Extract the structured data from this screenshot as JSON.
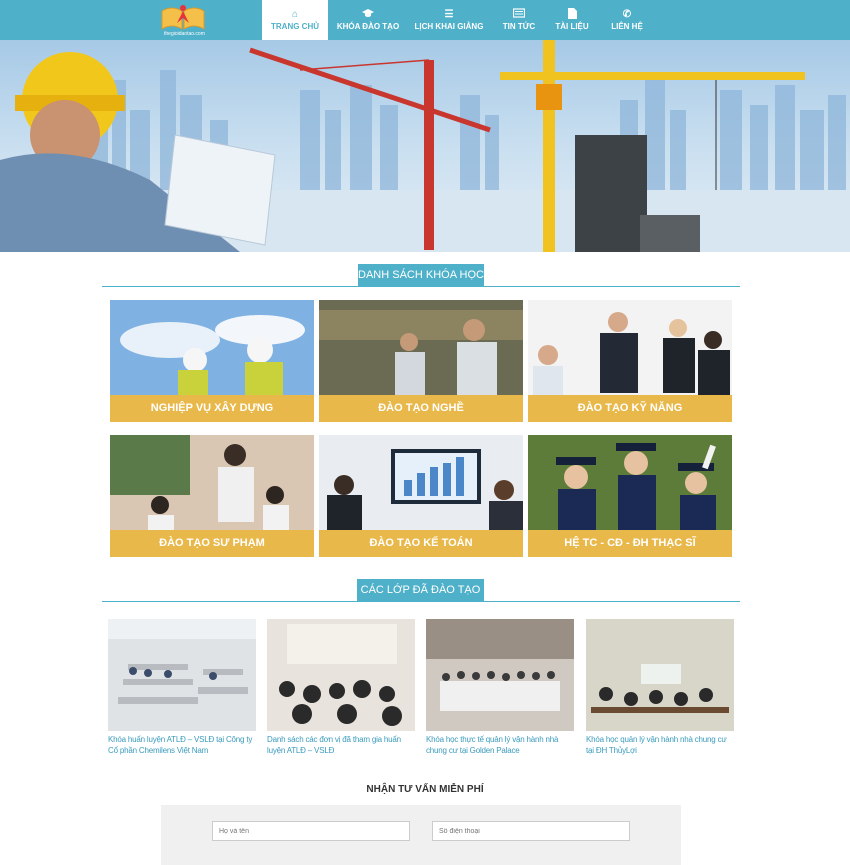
{
  "header": {
    "logo_text": "thegioidaotao.com",
    "nav": [
      {
        "label": "TRANG CHỦ",
        "icon": "home-icon"
      },
      {
        "label": "KHÓA ĐÀO TẠO",
        "icon": "graduation-cap-icon"
      },
      {
        "label": "LỊCH KHAI GIẢNG",
        "icon": "list-icon"
      },
      {
        "label": "TIN TỨC",
        "icon": "newspaper-icon"
      },
      {
        "label": "TÀI LIỆU",
        "icon": "document-icon"
      },
      {
        "label": "LIÊN HỆ",
        "icon": "phone-icon"
      }
    ],
    "active_index": 0
  },
  "courses": {
    "title": "DANH SÁCH KHÓA HỌC",
    "items": [
      {
        "label": "NGHIỆP VỤ XÂY DỰNG"
      },
      {
        "label": "ĐÀO TẠO NGHỀ"
      },
      {
        "label": "ĐÀO TẠO KỸ NĂNG"
      },
      {
        "label": "ĐÀO TẠO SƯ PHẠM"
      },
      {
        "label": "ĐÀO TẠO KẾ TOÁN"
      },
      {
        "label": "HỆ TC - CĐ - ĐH THẠC SĨ"
      }
    ]
  },
  "classes": {
    "title": "CÁC LỚP ĐÃ ĐÀO TẠO",
    "items": [
      {
        "caption": "Khóa huấn luyện ATLĐ – VSLĐ tại Công ty Cổ phần Chemilens Việt Nam"
      },
      {
        "caption": "Danh sách các đơn vị đã tham gia huấn luyện ATLĐ – VSLĐ"
      },
      {
        "caption": "Khóa học thực tế quản lý vận hành nhà chung cư tại Golden Palace"
      },
      {
        "caption": "Khóa học quản lý vận hành nhà chung cư tại ĐH ThủyLợi"
      }
    ]
  },
  "consult": {
    "title": "NHẬN TƯ VẤN MIỄN PHÍ",
    "name_placeholder": "Họ và tên",
    "phone_placeholder": "Số điện thoại"
  },
  "colors": {
    "primary": "#4fb0c9",
    "accent": "#e9b84a"
  }
}
